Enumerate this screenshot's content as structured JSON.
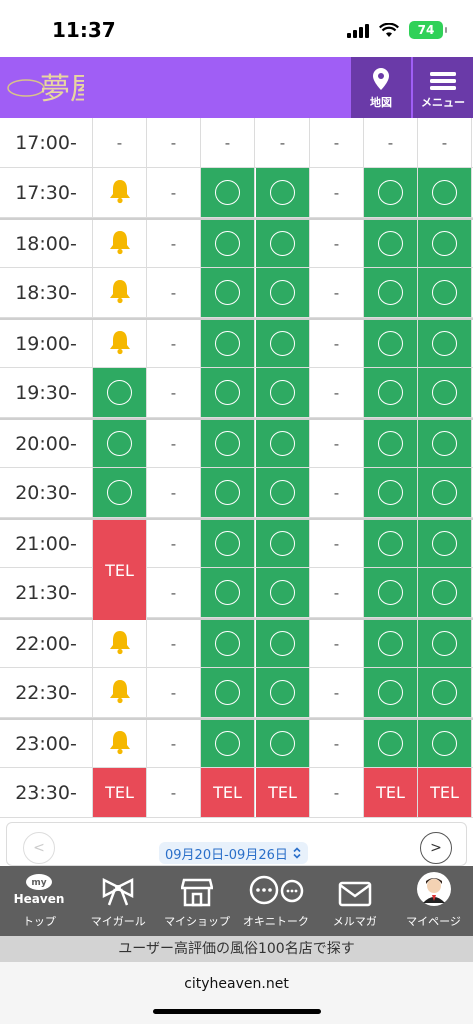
{
  "status": {
    "time": "11:37",
    "battery": "74"
  },
  "header": {
    "logo_text": "夢屋",
    "map_label": "地図",
    "menu_label": "メニュー"
  },
  "schedule": {
    "rows": [
      {
        "time": "17:00-",
        "cells": [
          "-",
          "-",
          "-",
          "-",
          "-",
          "-",
          "-"
        ]
      },
      {
        "time": "17:30-",
        "cells": [
          "bell",
          "-",
          "o",
          "o",
          "-",
          "o",
          "o"
        ]
      },
      {
        "time": "18:00-",
        "cells": [
          "bell",
          "-",
          "o",
          "o",
          "-",
          "o",
          "o"
        ]
      },
      {
        "time": "18:30-",
        "cells": [
          "bell",
          "-",
          "o",
          "o",
          "-",
          "o",
          "o"
        ]
      },
      {
        "time": "19:00-",
        "cells": [
          "bell",
          "-",
          "o",
          "o",
          "-",
          "o",
          "o"
        ]
      },
      {
        "time": "19:30-",
        "cells": [
          "o",
          "-",
          "o",
          "o",
          "-",
          "o",
          "o"
        ]
      },
      {
        "time": "20:00-",
        "cells": [
          "o",
          "-",
          "o",
          "o",
          "-",
          "o",
          "o"
        ]
      },
      {
        "time": "20:30-",
        "cells": [
          "o",
          "-",
          "o",
          "o",
          "-",
          "o",
          "o"
        ]
      },
      {
        "time": "21:00-",
        "cells": [
          "TEL",
          "-",
          "o",
          "o",
          "-",
          "o",
          "o"
        ]
      },
      {
        "time": "21:30-",
        "cells": [
          "TEL",
          "-",
          "o",
          "o",
          "-",
          "o",
          "o"
        ]
      },
      {
        "time": "22:00-",
        "cells": [
          "bell",
          "-",
          "o",
          "o",
          "-",
          "o",
          "o"
        ]
      },
      {
        "time": "22:30-",
        "cells": [
          "bell",
          "-",
          "o",
          "o",
          "-",
          "o",
          "o"
        ]
      },
      {
        "time": "23:00-",
        "cells": [
          "bell",
          "-",
          "o",
          "o",
          "-",
          "o",
          "o"
        ]
      },
      {
        "time": "23:30-",
        "cells": [
          "TEL",
          "-",
          "TEL",
          "TEL",
          "-",
          "TEL",
          "TEL"
        ]
      }
    ],
    "tel_label": "TEL",
    "dash_label": "-"
  },
  "pager": {
    "date_range": "09月20日-09月26日",
    "prev": "<",
    "next": ">"
  },
  "bottom_nav": [
    {
      "label": "トップ",
      "icon": "my-heaven-icon",
      "logo_line1": "my",
      "logo_line2": "Heaven"
    },
    {
      "label": "マイガール",
      "icon": "ribbon-icon"
    },
    {
      "label": "マイショップ",
      "icon": "shop-icon"
    },
    {
      "label": "オキニトーク",
      "icon": "chat-icon"
    },
    {
      "label": "メルマガ",
      "icon": "mail-icon"
    },
    {
      "label": "マイページ",
      "icon": "avatar-icon"
    }
  ],
  "banner": {
    "text": "ユーザー高評価の風俗100名店で探す"
  },
  "browser": {
    "url": "cityheaven.net"
  },
  "colors": {
    "header": "#a05ef5",
    "header_btn": "#6a3aa8",
    "available": "#2eaa62",
    "tel": "#e84a57",
    "bell": "#f5b800",
    "nav": "#5f5f5f"
  }
}
